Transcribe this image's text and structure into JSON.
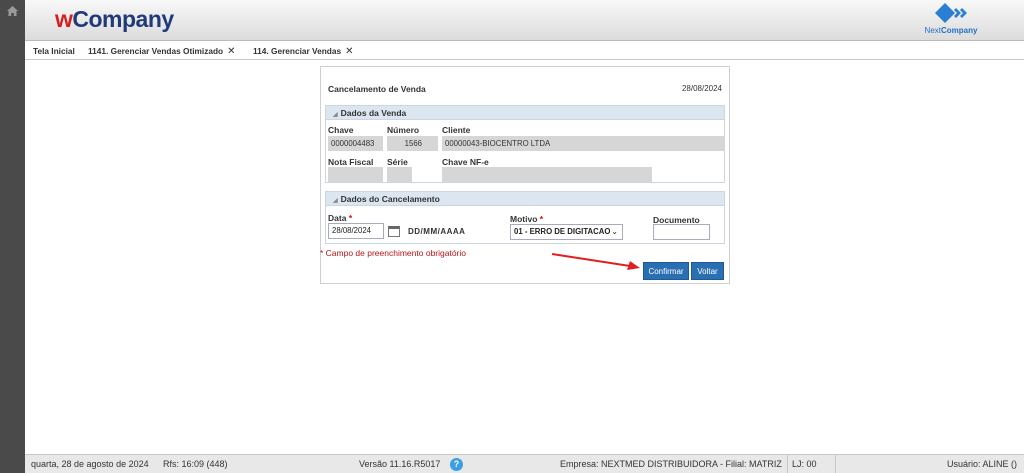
{
  "header": {
    "logo_prefix": "w",
    "logo_rest": "Company",
    "next_logo_a": "Next",
    "next_logo_b": "Company"
  },
  "tabs": [
    {
      "label": "Tela Inicial"
    },
    {
      "label": "1141. Gerenciar Vendas Otimizado",
      "close": "✕"
    },
    {
      "label": "114. Gerenciar Vendas",
      "close": "✕"
    }
  ],
  "form": {
    "title": "Cancelamento de Venda",
    "date": "28/08/2024",
    "sale_section": {
      "title": "Dados da Venda",
      "chave_label": "Chave",
      "chave_value": "0000004483",
      "numero_label": "Número",
      "numero_value": "1566",
      "cliente_label": "Cliente",
      "cliente_value": "00000043-BIOCENTRO LTDA",
      "nota_label": "Nota Fiscal",
      "nota_value": "",
      "serie_label": "Série",
      "serie_value": "",
      "chave_nfe_label": "Chave NF-e",
      "chave_nfe_value": ""
    },
    "cancel_section": {
      "title": "Dados do Cancelamento",
      "data_label": "Data",
      "data_value": "28/08/2024",
      "date_format": "DD/MM/AAAA",
      "motivo_label": "Motivo",
      "motivo_value": "01 - ERRO DE DIGITACAO",
      "documento_label": "Documento",
      "documento_value": ""
    },
    "required_star": "*",
    "mandatory_note": "* Campo de preenchimento obrigatório",
    "confirm_label": "Confirmar",
    "back_label": "Voltar"
  },
  "status": {
    "date": "quarta, 28 de agosto de 2024",
    "rfs": "Rfs: 16:09 (448)",
    "version": "Versão 11.16.R5017",
    "help": "?",
    "empresa": "Empresa: NEXTMED DISTRIBUIDORA - Filial: MATRIZ",
    "lj": "LJ: 00",
    "usuario": "Usuário: ALINE ()"
  },
  "colors": {
    "accent_button": "#2b6fb3",
    "annotation_arrow": "#e02020",
    "logo_red": "#d21f1f",
    "logo_blue": "#213a7a"
  },
  "icons": [
    "home-icon",
    "calendar-icon",
    "chevron-down-icon",
    "help-icon",
    "close-icon"
  ]
}
